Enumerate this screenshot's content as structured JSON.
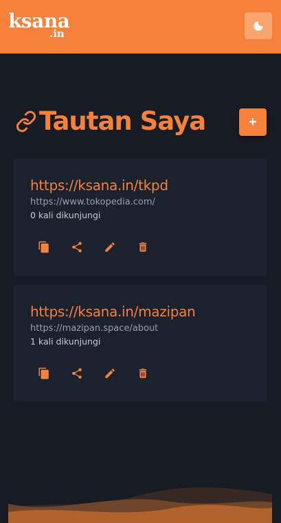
{
  "header": {
    "logo_main": "ksana",
    "logo_sub": ".in",
    "theme_icon": "moon-icon"
  },
  "main": {
    "title": "Tautan Saya",
    "title_icon": "link-icon",
    "add_label": "+"
  },
  "links": [
    {
      "short_url": "https://ksana.in/tkpd",
      "long_url": "https://www.tokopedia.com/",
      "visits": "0 kali dikunjungi"
    },
    {
      "short_url": "https://ksana.in/mazipan",
      "long_url": "https://mazipan.space/about",
      "visits": "1 kali dikunjungi"
    }
  ],
  "actions": [
    "copy-icon",
    "share-icon",
    "edit-icon",
    "delete-icon"
  ],
  "colors": {
    "accent": "#f5813a",
    "background": "#161b24",
    "card": "#1c222d"
  }
}
